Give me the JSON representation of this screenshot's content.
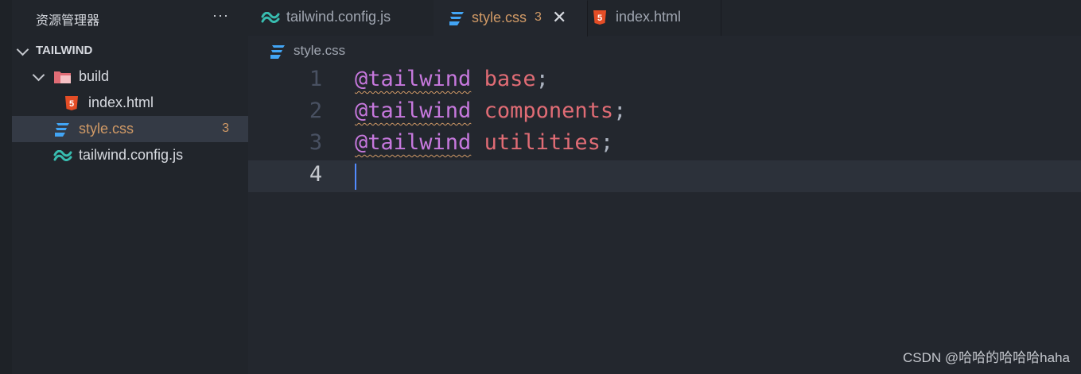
{
  "sidebar": {
    "title": "资源管理器",
    "more_label": "···",
    "section": "TAILWIND",
    "items": [
      {
        "label": "build",
        "type": "folder"
      },
      {
        "label": "index.html",
        "type": "html"
      },
      {
        "label": "style.css",
        "type": "css",
        "count": "3"
      },
      {
        "label": "tailwind.config.js",
        "type": "tailwind"
      }
    ]
  },
  "tabs": [
    {
      "label": "tailwind.config.js",
      "icon": "tailwind-icon"
    },
    {
      "label": "style.css",
      "icon": "css-icon",
      "count": "3",
      "close": "✕"
    },
    {
      "label": "index.html",
      "icon": "html-icon"
    }
  ],
  "breadcrumb": {
    "file": "style.css"
  },
  "editor": {
    "lines": [
      {
        "num": "1",
        "at": "@tailwind",
        "kw": "base",
        "punc": ";"
      },
      {
        "num": "2",
        "at": "@tailwind",
        "kw": "components",
        "punc": ";"
      },
      {
        "num": "3",
        "at": "@tailwind",
        "kw": "utilities",
        "punc": ";"
      },
      {
        "num": "4"
      }
    ]
  },
  "watermark": "CSDN @哈哈的哈哈哈haha",
  "colors": {
    "accent_orange": "#d19a66",
    "keyword_red": "#e06c75",
    "at_purple": "#c678dd",
    "css_blue": "#42a5f5",
    "html_orange": "#e44d26",
    "tailwind_teal": "#38bdb0",
    "cursor_blue": "#528bff"
  }
}
